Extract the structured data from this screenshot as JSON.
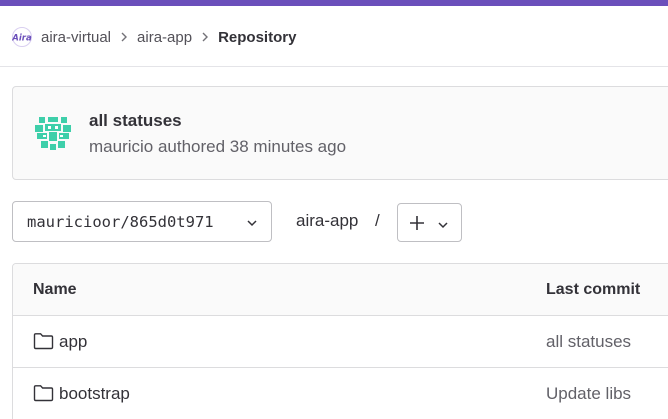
{
  "colors": {
    "top_bar": "#6b4fbb",
    "avatar": "#3ecfaa",
    "logo": "#6b4fbb"
  },
  "breadcrumb": {
    "logo_icon": "aira-logo-icon",
    "items": [
      {
        "label": "aira-virtual"
      },
      {
        "label": "aira-app"
      },
      {
        "label": "Repository"
      }
    ],
    "separator_icon": "chevron-right-icon"
  },
  "last_commit": {
    "title": "all statuses",
    "meta": "mauricio authored 38 minutes ago",
    "avatar_icon": "identicon-avatar"
  },
  "toolbar": {
    "branch": "mauricioor/865d0t971",
    "path": "aira-app",
    "path_separator": "/",
    "add_icon": "plus-icon"
  },
  "file_table": {
    "columns": [
      "Name",
      "Last commit"
    ],
    "rows": [
      {
        "icon": "folder-icon",
        "name": "app",
        "last_commit": "all statuses"
      },
      {
        "icon": "folder-icon",
        "name": "bootstrap",
        "last_commit": "Update libs"
      }
    ]
  }
}
